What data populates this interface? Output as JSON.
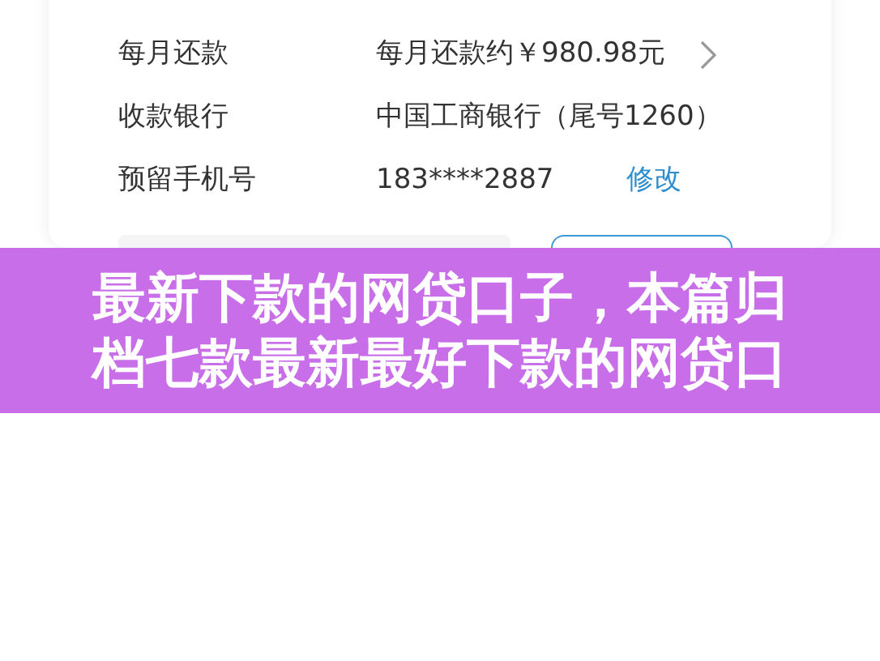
{
  "form": {
    "rows": [
      {
        "kind": "chevron",
        "label": "每月还款",
        "value": "每月还款约￥980.98元"
      },
      {
        "kind": "plain",
        "label": "收款银行",
        "value": "中国工商银行（尾号1260）"
      },
      {
        "kind": "link",
        "label": "预留手机号",
        "value": "183****2887",
        "action": "修改"
      }
    ]
  },
  "banner": {
    "lines": [
      "最新下款的网贷口子，本篇归",
      "档七款最新最好下款的网贷口"
    ]
  }
}
